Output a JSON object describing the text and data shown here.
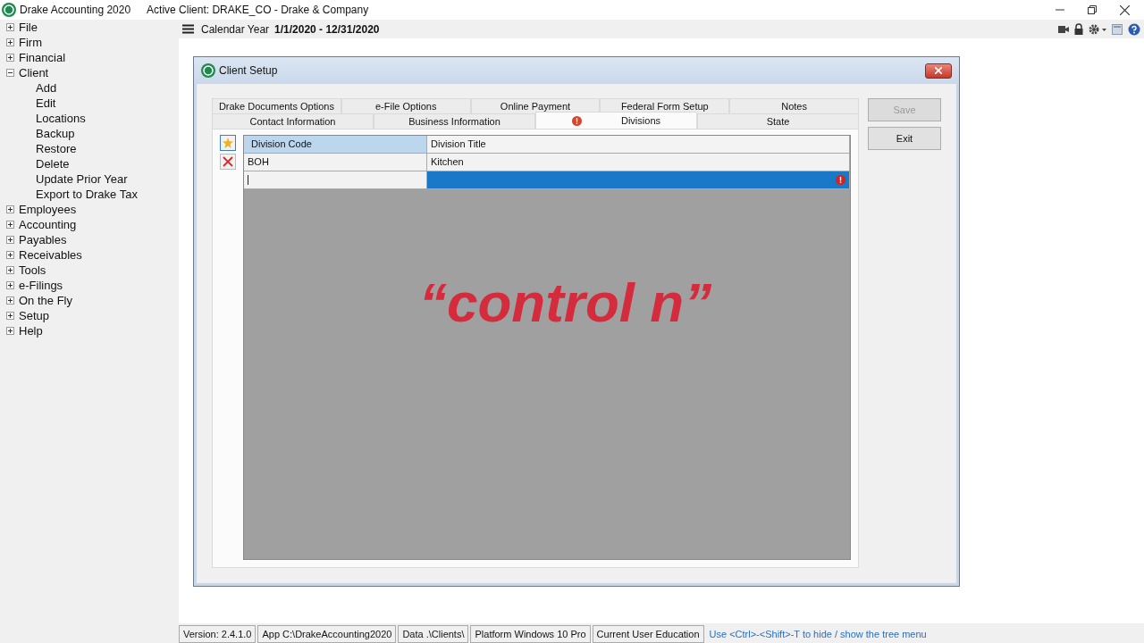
{
  "app": {
    "title": "Drake Accounting 2020",
    "active_client": "Active Client: DRAKE_CO - Drake & Company"
  },
  "tree": [
    {
      "label": "File",
      "expanded": false
    },
    {
      "label": "Firm",
      "expanded": false
    },
    {
      "label": "Financial",
      "expanded": false
    },
    {
      "label": "Client",
      "expanded": true,
      "children": [
        {
          "label": "Add"
        },
        {
          "label": "Edit"
        },
        {
          "label": "Locations"
        },
        {
          "label": "Backup"
        },
        {
          "label": "Restore"
        },
        {
          "label": "Delete"
        },
        {
          "label": "Update Prior Year"
        },
        {
          "label": "Export to Drake Tax"
        }
      ]
    },
    {
      "label": "Employees",
      "expanded": false
    },
    {
      "label": "Accounting",
      "expanded": false
    },
    {
      "label": "Payables",
      "expanded": false
    },
    {
      "label": "Receivables",
      "expanded": false
    },
    {
      "label": "Tools",
      "expanded": false
    },
    {
      "label": "e-Filings",
      "expanded": false
    },
    {
      "label": "On the Fly",
      "expanded": false
    },
    {
      "label": "Setup",
      "expanded": false
    },
    {
      "label": "Help",
      "expanded": false
    }
  ],
  "toolbar": {
    "label": "Calendar Year",
    "value": "1/1/2020 - 12/31/2020"
  },
  "dialog": {
    "title": "Client Setup",
    "tab_rows": [
      {
        "tabs": [
          {
            "label": "Drake Documents Options",
            "selected": false,
            "error": false
          },
          {
            "label": "e-File Options",
            "selected": false,
            "error": false
          },
          {
            "label": "Online Payment",
            "selected": false,
            "error": false
          },
          {
            "label": "Federal Form Setup",
            "selected": false,
            "error": false
          },
          {
            "label": "Notes",
            "selected": false,
            "error": false
          }
        ]
      },
      {
        "tabs": [
          {
            "label": "Contact Information",
            "selected": false,
            "error": false
          },
          {
            "label": "Business Information",
            "selected": false,
            "error": false
          },
          {
            "label": "Divisions",
            "selected": true,
            "error": true
          },
          {
            "label": "State",
            "selected": false,
            "error": false
          }
        ]
      }
    ],
    "grid": {
      "columns": [
        "Division Code",
        "Division Title"
      ],
      "rows": [
        {
          "cells": [
            "BOH",
            "Kitchen"
          ],
          "selected": false,
          "error": false
        },
        {
          "selected": true,
          "error": true
        }
      ]
    },
    "buttons": [
      {
        "label": "Save",
        "disabled": true
      },
      {
        "label": "Exit",
        "disabled": false
      }
    ]
  },
  "caption": "“control n”",
  "status_bar": {
    "panels": [
      "Version: 2.4.1.0",
      "App C:\\DrakeAccounting2020",
      "Data .\\Clients\\",
      "Platform Windows 10 Pro",
      "Current User Education"
    ],
    "hint": "Use <Ctrl>-<Shift>-T to hide / show the tree menu"
  }
}
